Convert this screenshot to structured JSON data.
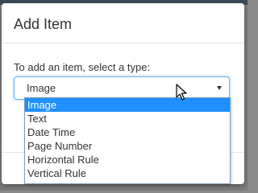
{
  "modal": {
    "title": "Add Item",
    "prompt": "To add an item, select a type:"
  },
  "select": {
    "value": "Image",
    "options": [
      {
        "label": "Image",
        "selected": true
      },
      {
        "label": "Text",
        "selected": false
      },
      {
        "label": "Date Time",
        "selected": false
      },
      {
        "label": "Page Number",
        "selected": false
      },
      {
        "label": "Horizontal Rule",
        "selected": false
      },
      {
        "label": "Vertical Rule",
        "selected": false
      }
    ]
  },
  "icons": {
    "dropdown": "chevron-down-icon",
    "cursor": "mouse-pointer-icon"
  },
  "colors": {
    "selected_option_bg": "#1e90ff",
    "focus_border": "#66afe9"
  }
}
